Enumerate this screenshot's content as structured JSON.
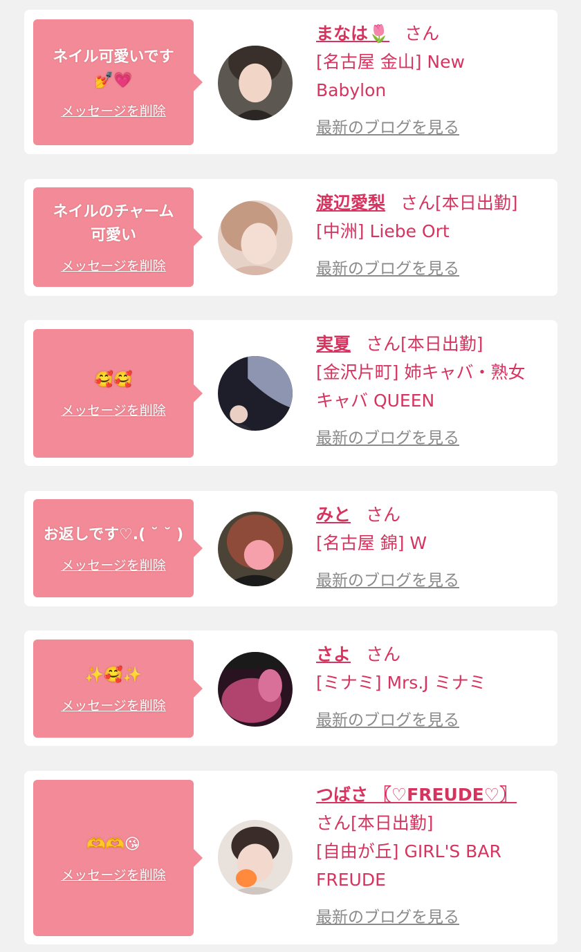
{
  "delete_label": "メッセージを削除",
  "blog_label": "最新のブログを見る",
  "san": "さん",
  "items": [
    {
      "message_lines": [
        "ネイル可愛いです",
        "💅💗"
      ],
      "name": "まなは🌷",
      "work": "",
      "shop_lines": [
        "[名古屋 金山] New",
        "Babylon"
      ]
    },
    {
      "message_lines": [
        "ネイルのチャーム",
        "可愛い"
      ],
      "name": "渡辺愛梨",
      "work": "[本日出勤]",
      "shop_lines": [
        "[中洲] Liebe Ort"
      ]
    },
    {
      "message_lines": [
        "🥰🥰"
      ],
      "name": "実夏",
      "work": "[本日出勤]",
      "shop_lines": [
        "[金沢片町] 姉キャバ・熟女",
        "キャバ QUEEN"
      ]
    },
    {
      "message_lines": [
        "お返しです♡.( ˘ ˘ )"
      ],
      "name": "みと",
      "work": "",
      "shop_lines": [
        "[名古屋 錦] W"
      ]
    },
    {
      "message_lines": [
        "✨🥰✨"
      ],
      "name": "さよ",
      "work": "",
      "shop_lines": [
        "[ミナミ] Mrs.J ミナミ"
      ]
    },
    {
      "message_lines": [
        "🫶🫶😘"
      ],
      "name": "つばさ 〖♡FREUDE♡〗",
      "work": "[本日出勤]",
      "shop_lines": [
        "[自由が丘] GIRL'S BAR",
        "FREUDE"
      ]
    }
  ],
  "colors": {
    "bubble": "#f28b97",
    "accent": "#d6345f",
    "link_gray": "#8a8a8a"
  }
}
